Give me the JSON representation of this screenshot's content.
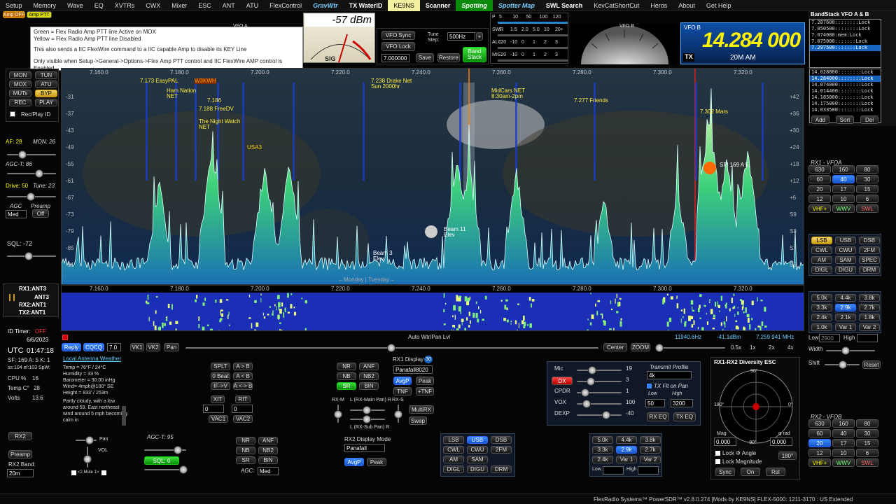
{
  "menu": [
    "Setup",
    "Memory",
    "Wave",
    "EQ",
    "XVTRs",
    "CWX",
    "Mixer",
    "ESC",
    "ANT",
    "ATU",
    "FlexControl",
    "GravWtr",
    "TX WaterID",
    "KE9NS",
    "Scanner",
    "Spotting",
    "Spotter Map",
    "SWL Search",
    "KevCatShortCut",
    "Heros",
    "About",
    "Get Help"
  ],
  "amp": {
    "off": "Amp OFF",
    "ptt": "Amp PTT"
  },
  "tooltip": {
    "line1": "Green = Flex Radio Amp PTT line Active on MOX",
    "line2": "Yellow = Flex Radio Amp PTT line Disabled",
    "line3": "This also sends a IIC FlexWire command to a IIC capable Amp to disable its KEY Line",
    "line4": "Only visible when Setup->General->Options->Flex Amp PTT control and IIC FlexWire AMP control is Enabled"
  },
  "meter": {
    "dbm": "-57 dBm",
    "sig": "SIG"
  },
  "vfo_sync": "VFO Sync",
  "vfo_lock": "VFO Lock",
  "tune_step_label": "Tune Step:",
  "tune_step": "500Hz",
  "vfo_freq_field": "7.000000",
  "save": "Save",
  "restore": "Restore",
  "band_stack_btn": "Band Stack",
  "sub_meter": {
    "row1": [
      "P",
      "5",
      "10",
      "50",
      "100",
      "120"
    ],
    "row2": [
      "SWR",
      "1",
      "1.5",
      "2.0",
      "5.0",
      "10",
      "20+"
    ],
    "row3": [
      "ALC",
      "-20",
      "-10",
      "0",
      "1",
      "2",
      "3"
    ],
    "row4": [
      "MIC",
      "-20",
      "-10",
      "0",
      "1",
      "2",
      "3"
    ]
  },
  "vfob": {
    "label": "VFO B",
    "freq": "14.284 000",
    "mode": "20M AM",
    "tx": "TX"
  },
  "vfoa_label": "VFO A",
  "vfob_dial": "VFO B",
  "bandstack": {
    "title": "BandStack VFO A & B",
    "a": [
      "7.287600::::::::Lock",
      "7.050500::::::::Lock",
      "7.074000:mem:Lock",
      "7.075000:::::::Lock",
      "7.297500:::::::Lock"
    ],
    "b": [
      "14.028000::::::::Lock",
      "14.284000::::::::Lock",
      "14.074000::::::::Lock",
      "14.014400::::::::Lock",
      "14.185000::::::::Lock",
      "14.175000::::::::Lock",
      "14.033500::::::::Lock"
    ],
    "add": "Add",
    "sort": "Sort",
    "del": "Del"
  },
  "left_btns": [
    [
      "MON",
      "TUN"
    ],
    [
      "MOX",
      "ATU"
    ],
    [
      "MUTs",
      "BYP"
    ],
    [
      "REC",
      "PLAY"
    ]
  ],
  "rec_play_id": "Rec/Play ID",
  "af": "AF: 28",
  "mon": "MON: 26",
  "agct": "AGC-T: 86",
  "drive": "Drive: 50",
  "tune": "Tune: 23",
  "agc": "AGC",
  "preamp": "Preamp",
  "agc_val": "Med",
  "preamp_val": "Off",
  "sql": "SQL: -72",
  "ant": {
    "rx1": "RX1:ANT3",
    "tx1": "ANT3",
    "rx2": "RX2:ANT1",
    "tx2": "TX2:ANT1"
  },
  "pan_freqs": [
    "7.160.0",
    "7.180.0",
    "7.200.0",
    "7.220.0",
    "7.240.0",
    "7.260.0",
    "7.280.0",
    "7.300.0",
    "7.320.0"
  ],
  "wf_freqs": [
    "7.160.0",
    "7.180.0",
    "7.200.0",
    "7.220.0",
    "7.240.0",
    "7.260.0",
    "7.280.0",
    "7.300.0",
    "7.320.0"
  ],
  "db_left": [
    "-31",
    "-37",
    "-43",
    "-49",
    "-55",
    "-61",
    "-67",
    "-73",
    "-79",
    "-85",
    "-91"
  ],
  "db_right": [
    "+42",
    "+36",
    "+30",
    "+24",
    "+18",
    "+12",
    "+6",
    "S9",
    "S8",
    "S7",
    "S6"
  ],
  "spots": [
    {
      "t": "7.173 EasyPAL"
    },
    {
      "t": "Ham Nation NET"
    },
    {
      "t": "W3KWH"
    },
    {
      "t": "7.186"
    },
    {
      "t": "7.188 FreeDV"
    },
    {
      "t": "The Night Watch NET"
    },
    {
      "t": "7.238 Drake Net Sun 2000hr"
    },
    {
      "t": "MidCars NET 8:30am-2pm"
    },
    {
      "t": "7.277 Friends"
    },
    {
      "t": "7.302 Mars"
    }
  ],
  "map_labels": {
    "usa": "USA3",
    "sfi": "SFI 169 A 5,",
    "beam1": "Beam 11 Elev",
    "beam2": "Beam 3 Elev",
    "days": "←Monday | Tuesday→"
  },
  "id_timer": "ID Timer:",
  "idt_val": "OFF",
  "date": "6/6/2023",
  "utc": "UTC",
  "utc_time": "01:47:18",
  "stats": {
    "sf": "SF: 169 A: 5 K: 1",
    "ss": "ss:104 ef:103 SpW:",
    "cpu_l": "CPU %",
    "cpu_v": "16",
    "temp_l": "Temp C°",
    "temp_v": "28",
    "volts_l": "Volts",
    "volts_v": "13.6"
  },
  "tx_row": {
    "reply": "Reply",
    "cqcq": "CQCQ",
    "val": "7.0",
    "vk1": "VK1",
    "vk2": "VK2",
    "pan": "Pan"
  },
  "auto_wtr": "Auto Wtr/Pan Lvl",
  "center": "Center",
  "zoom": "ZOOM",
  "zooms": [
    "0.5x",
    "1x",
    "2x",
    "4x"
  ],
  "cursor_readout": {
    "f": "11940.6Hz",
    "db": "-41.1dBm",
    "mhz": "7.259 941 MHz"
  },
  "weather": {
    "title": "Local Antenna Weather",
    "lines": [
      "Temp = 76°F / 24°C",
      "Humidity = 33 %",
      "Barometer = 30.00 inHg",
      "Wind= 4mph@100° SE",
      "Height = 833' / 253m",
      "Partly cloudy, with a low around 59. East northeast wind around 5 mph becoming calm in"
    ]
  },
  "split": {
    "splt": "SPLT",
    "ab": "A > B",
    "zb": "0 Beat",
    "ab2": "A < B",
    "ifb": "IF->V",
    "ax": "A <-> B",
    "xit": "XIT",
    "xit_v": "0",
    "rit": "RIT",
    "rit_v": "0",
    "vac1": "VAC1",
    "vac2": "VAC2"
  },
  "nr": {
    "nr": "NR",
    "anf": "ANF",
    "nb": "NB",
    "nb2": "NB2",
    "sr": "SR",
    "bin": "BIN"
  },
  "rxm": {
    "rxm": "RX-M",
    "lbl1": "L (RX-Main Pan) R",
    "rxs": "RX-S",
    "lbl2": "L (RX-Sub Pan) R"
  },
  "rx1display": {
    "label": "RX1 Display",
    "num": "30",
    "mode": "Panafall8020",
    "avg": "AvgP",
    "peak": "Peak",
    "tnf": "TNF",
    "ptnf": "+TNF",
    "multirx": "MultiRX",
    "swap": "Swap"
  },
  "rx2display": {
    "label": "RX2 Display Mode",
    "mode": "Panafall",
    "avg": "AvgP",
    "peak": "Peak"
  },
  "rx2nr": {
    "nr": "NR",
    "anf": "ANF",
    "nb": "NB",
    "nb2": "NB2",
    "sr": "SR",
    "bin": "BIN",
    "agc": "AGC:",
    "agc_v": "Med"
  },
  "rx2left": {
    "rx2": "RX2",
    "preamp": "Preamp",
    "band_l": "RX2 Band:",
    "band": "20m",
    "pan": "Pan",
    "vol": "VOL",
    "mute": "<2 Mute 1>"
  },
  "rx2agc": "AGC-T: 95",
  "rx2sql": "SQL: 0",
  "rx2modes": [
    [
      "LSB",
      "USB",
      "DSB"
    ],
    [
      "CWL",
      "CWU",
      "2FM"
    ],
    [
      "AM",
      "SAM",
      ""
    ],
    [
      "DIGL",
      "DIGU",
      "DRM"
    ]
  ],
  "rx2filters": [
    [
      "5.0k",
      "4.4k",
      "3.8k"
    ],
    [
      "3.3k",
      "2.9k",
      "2.7k"
    ],
    [
      "2.4k",
      "Var 1",
      "Var 2"
    ]
  ],
  "rx2low": "Low",
  "rx2high": "High",
  "mic": {
    "mic": "Mic",
    "mic_v": "19",
    "dx": "DX",
    "dx_v": "3",
    "cpdr": "CPDR",
    "cpdr_v": "1",
    "vox": "VOX",
    "vox_v": "100",
    "dexp": "DEXP",
    "dexp_v": "-40"
  },
  "txprofile": {
    "label": "Transmit Profile",
    "val": "4k",
    "txflt": "TX Flt on Pan",
    "low": "Low",
    "high": "High",
    "low_v": "50",
    "high_v": "3200",
    "rxeq": "RX EQ",
    "txeq": "TX EQ"
  },
  "diversity": {
    "title": "RX1-RX2 Diversity ESC",
    "mag": "Mag",
    "rad": "φ rad",
    "mag_v": "0.000",
    "rad_v": "0.000",
    "n90": "90°",
    "s90": "-90°",
    "w180": "180°",
    "e0": "0°",
    "lock_angle": "Lock Φ Angle",
    "lock_mag": "Lock Magnitude",
    "deg180": "180°",
    "sync": "Sync",
    "on": "On",
    "rst": "Rst"
  },
  "rx1vfoa": {
    "title": "RX1 - VFOA",
    "bands": [
      "630",
      "160",
      "80",
      "60",
      "40",
      "30",
      "20",
      "17",
      "15",
      "12",
      "10",
      "6",
      "VHF+",
      "WWV",
      "SWL"
    ]
  },
  "rx1modes": [
    [
      "LSB",
      "USB",
      "DSB"
    ],
    [
      "CWL",
      "CWU",
      "2FM"
    ],
    [
      "AM",
      "SAM",
      "SPEC"
    ],
    [
      "DIGL",
      "DIGU",
      "DRM"
    ]
  ],
  "rx1filters": [
    [
      "5.0k",
      "4.4k",
      "3.8k"
    ],
    [
      "3.3k",
      "2.9k",
      "2.7k"
    ],
    [
      "2.4k",
      "2.1k",
      "1.8k"
    ],
    [
      "1.0k",
      "Var 1",
      "Var 2"
    ]
  ],
  "rx1low": "Low",
  "rx1high": "High",
  "rx1low_v": "2900",
  "width": "Width",
  "shift": "Shift",
  "reset": "Reset",
  "rx2vfob": {
    "title": "RX2 - VFOB",
    "bands": [
      "630",
      "160",
      "80",
      "60",
      "40",
      "30",
      "20",
      "17",
      "15",
      "12",
      "10",
      "6",
      "VHF+",
      "WWV",
      "SWL"
    ]
  },
  "status": "FlexRadio Systems™  PowerSDR™ v2.8.0.274  [Mods by KE9NS]   FLEX-5000: 1211-3170 : US Extended",
  "colors": {
    "accent": "#2aa3ff",
    "spectrum": "#2bd6b0",
    "vfo": "#fff200"
  }
}
